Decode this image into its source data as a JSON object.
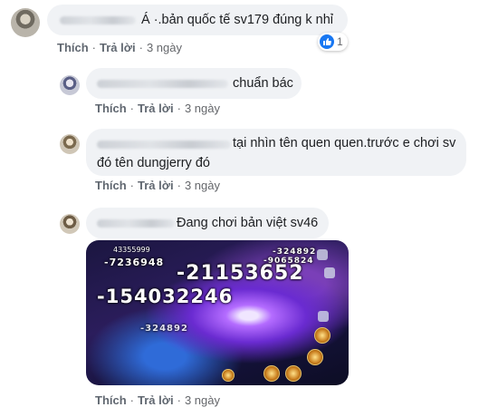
{
  "common": {
    "like_label": "Thích",
    "reply_label": "Trả lời",
    "separator": "·"
  },
  "comments": [
    {
      "text": "Á ·.bản quốc tế sv179 đúng k nhỉ",
      "time": "3 ngày",
      "reactions": "1"
    },
    {
      "text": "chuẩn bác",
      "time": "3 ngày"
    },
    {
      "text": "tại nhìn tên quen quen.trước e chơi sv đó tên dungjerry đó",
      "time": "3 ngày"
    },
    {
      "text": "Đang chơi bản việt sv46",
      "time": "3 ngày"
    }
  ],
  "game_screenshot": {
    "damage_numbers": [
      "-21153652",
      "-154032246",
      "-7236948",
      "-9065824",
      "-324892",
      "-324892"
    ],
    "hud_value": "43355999"
  },
  "colors": {
    "bubble": "#f0f2f5",
    "accent": "#1877f2",
    "muted": "#65676b"
  }
}
